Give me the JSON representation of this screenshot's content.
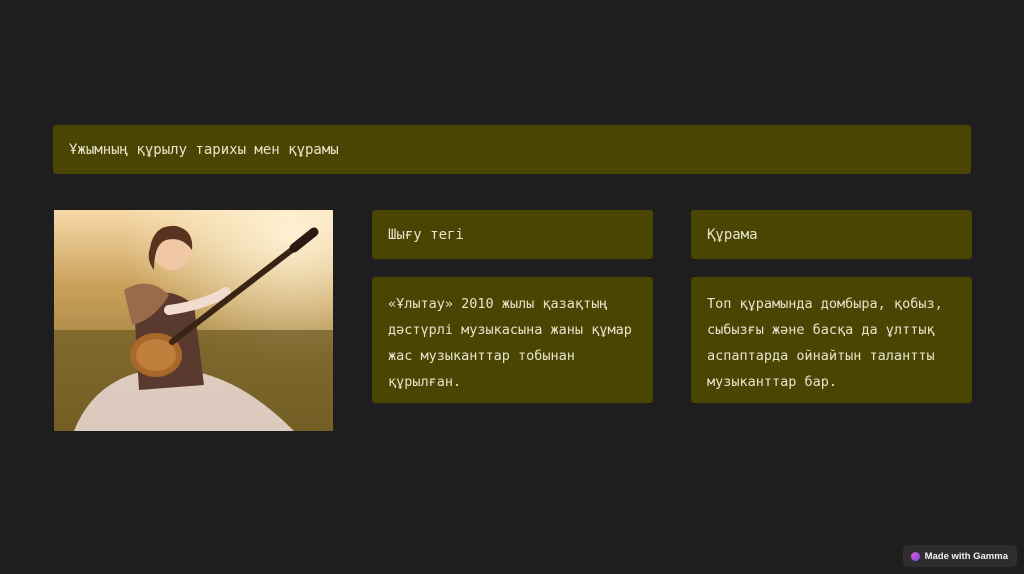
{
  "slide": {
    "title": "Ұжымның құрылу тарихы мен құрамы",
    "left_card": {
      "heading": "Шығу тегі",
      "body": "«Ұлытау» 2010 жылы қазақтың дәстүрлі музыкасына жаны құмар жас музыканттар тобынан құрылған."
    },
    "right_card": {
      "heading": "Құрама",
      "body": "Топ құрамында домбыра, қобыз, сыбызғы және басқа да ұлттық аспаптарда ойнайтын талантты музыканттар бар."
    }
  },
  "badge": {
    "label": "Made with Gamma",
    "icon": "gamma-logo-icon"
  },
  "colors": {
    "background": "#1e1e1e",
    "card": "#4a4502",
    "text": "#e8e4cc"
  }
}
